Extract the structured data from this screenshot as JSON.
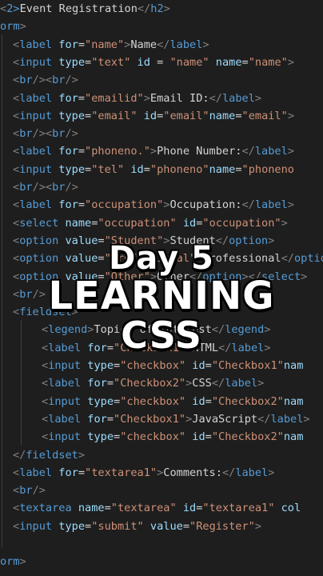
{
  "editor": {
    "lines": [
      [
        [
          "b",
          "<"
        ],
        [
          "n",
          "2>"
        ],
        [
          "x",
          "Event Registration"
        ],
        [
          "b",
          "</"
        ],
        [
          "t",
          "h2"
        ],
        [
          "b",
          ">"
        ]
      ],
      [
        [
          "t",
          "orm"
        ],
        [
          "b",
          ">"
        ]
      ],
      [
        [
          "b",
          "<"
        ],
        [
          "t",
          "label"
        ],
        [
          "x",
          " "
        ],
        [
          "a",
          "for"
        ],
        [
          "p",
          "="
        ],
        [
          "s",
          "\"name\""
        ],
        [
          "b",
          ">"
        ],
        [
          "x",
          "Name"
        ],
        [
          "b",
          "</"
        ],
        [
          "t",
          "label"
        ],
        [
          "b",
          ">"
        ]
      ],
      [
        [
          "b",
          "<"
        ],
        [
          "t",
          "input"
        ],
        [
          "x",
          " "
        ],
        [
          "a",
          "type"
        ],
        [
          "p",
          "="
        ],
        [
          "s",
          "\"text\""
        ],
        [
          "x",
          " "
        ],
        [
          "a",
          "id"
        ],
        [
          "p",
          " = "
        ],
        [
          "s",
          "\"name\""
        ],
        [
          "x",
          " "
        ],
        [
          "a",
          "name"
        ],
        [
          "p",
          "="
        ],
        [
          "s",
          "\"name\""
        ],
        [
          "b",
          ">"
        ]
      ],
      [
        [
          "b",
          "<"
        ],
        [
          "t",
          "br"
        ],
        [
          "b",
          "/><"
        ],
        [
          "t",
          "br"
        ],
        [
          "b",
          "/>"
        ]
      ],
      [
        [
          "b",
          "<"
        ],
        [
          "t",
          "label"
        ],
        [
          "x",
          " "
        ],
        [
          "a",
          "for"
        ],
        [
          "p",
          "="
        ],
        [
          "s",
          "\"emailid\""
        ],
        [
          "b",
          ">"
        ],
        [
          "x",
          "Email ID:"
        ],
        [
          "b",
          "</"
        ],
        [
          "t",
          "label"
        ],
        [
          "b",
          ">"
        ]
      ],
      [
        [
          "b",
          "<"
        ],
        [
          "t",
          "input"
        ],
        [
          "x",
          " "
        ],
        [
          "a",
          "type"
        ],
        [
          "p",
          "="
        ],
        [
          "s",
          "\"email\""
        ],
        [
          "x",
          " "
        ],
        [
          "a",
          "id"
        ],
        [
          "p",
          "="
        ],
        [
          "s",
          "\"email\""
        ],
        [
          "a",
          "name"
        ],
        [
          "p",
          "="
        ],
        [
          "s",
          "\"email\""
        ],
        [
          "b",
          ">"
        ]
      ],
      [
        [
          "b",
          "<"
        ],
        [
          "t",
          "br"
        ],
        [
          "b",
          "/><"
        ],
        [
          "t",
          "br"
        ],
        [
          "b",
          "/>"
        ]
      ],
      [
        [
          "b",
          "<"
        ],
        [
          "t",
          "label"
        ],
        [
          "x",
          " "
        ],
        [
          "a",
          "for"
        ],
        [
          "p",
          "="
        ],
        [
          "s",
          "\"phoneno.\""
        ],
        [
          "b",
          ">"
        ],
        [
          "x",
          "Phone Number:"
        ],
        [
          "b",
          "</"
        ],
        [
          "t",
          "label"
        ],
        [
          "b",
          ">"
        ]
      ],
      [
        [
          "b",
          "<"
        ],
        [
          "t",
          "input"
        ],
        [
          "x",
          " "
        ],
        [
          "a",
          "type"
        ],
        [
          "p",
          "="
        ],
        [
          "s",
          "\"tel\""
        ],
        [
          "x",
          " "
        ],
        [
          "a",
          "id"
        ],
        [
          "p",
          "="
        ],
        [
          "s",
          "\"phoneno\""
        ],
        [
          "a",
          "name"
        ],
        [
          "p",
          "="
        ],
        [
          "s",
          "\"phoneno"
        ]
      ],
      [
        [
          "b",
          "<"
        ],
        [
          "t",
          "br"
        ],
        [
          "b",
          "/><"
        ],
        [
          "t",
          "br"
        ],
        [
          "b",
          "/>"
        ]
      ],
      [
        [
          "b",
          "<"
        ],
        [
          "t",
          "label"
        ],
        [
          "x",
          " "
        ],
        [
          "a",
          "for"
        ],
        [
          "p",
          "="
        ],
        [
          "s",
          "\"occupation\""
        ],
        [
          "b",
          ">"
        ],
        [
          "x",
          "Occupation:"
        ],
        [
          "b",
          "</"
        ],
        [
          "t",
          "label"
        ],
        [
          "b",
          ">"
        ]
      ],
      [
        [
          "b",
          "<"
        ],
        [
          "t",
          "select"
        ],
        [
          "x",
          " "
        ],
        [
          "a",
          "name"
        ],
        [
          "p",
          "="
        ],
        [
          "s",
          "\"occupation\""
        ],
        [
          "x",
          " "
        ],
        [
          "a",
          "id"
        ],
        [
          "p",
          "="
        ],
        [
          "s",
          "\"occupation\""
        ],
        [
          "b",
          ">"
        ]
      ],
      [
        [
          "b",
          "<"
        ],
        [
          "t",
          "option"
        ],
        [
          "x",
          " "
        ],
        [
          "a",
          "value"
        ],
        [
          "p",
          "="
        ],
        [
          "s",
          "\"Student\""
        ],
        [
          "b",
          ">"
        ],
        [
          "x",
          "Student"
        ],
        [
          "b",
          "</"
        ],
        [
          "t",
          "option"
        ],
        [
          "b",
          ">"
        ]
      ],
      [
        [
          "b",
          "<"
        ],
        [
          "t",
          "option"
        ],
        [
          "x",
          " "
        ],
        [
          "a",
          "value"
        ],
        [
          "p",
          "="
        ],
        [
          "s",
          "\"Professional\""
        ],
        [
          "b",
          ">"
        ],
        [
          "x",
          "Professional"
        ],
        [
          "b",
          "</"
        ],
        [
          "t",
          "option"
        ],
        [
          "b",
          ">"
        ]
      ],
      [
        [
          "b",
          "<"
        ],
        [
          "t",
          "option"
        ],
        [
          "x",
          " "
        ],
        [
          "a",
          "value"
        ],
        [
          "p",
          "="
        ],
        [
          "s",
          "\"Other\""
        ],
        [
          "b",
          ">"
        ],
        [
          "x",
          "Other"
        ],
        [
          "b",
          "</"
        ],
        [
          "t",
          "option"
        ],
        [
          "b",
          "></"
        ],
        [
          "t",
          "select"
        ],
        [
          "b",
          ">"
        ]
      ],
      [
        [
          "b",
          "<"
        ],
        [
          "t",
          "br"
        ],
        [
          "b",
          "/>"
        ]
      ],
      [
        [
          "b",
          "<"
        ],
        [
          "t",
          "fieldset"
        ],
        [
          "b",
          ">"
        ]
      ],
      [
        [
          "b",
          "<"
        ],
        [
          "t",
          "legend"
        ],
        [
          "b",
          ">"
        ],
        [
          "x",
          "Topics of interest"
        ],
        [
          "b",
          "</"
        ],
        [
          "t",
          "legend"
        ],
        [
          "b",
          ">"
        ]
      ],
      [
        [
          "b",
          "<"
        ],
        [
          "t",
          "label"
        ],
        [
          "x",
          " "
        ],
        [
          "a",
          "for"
        ],
        [
          "p",
          "="
        ],
        [
          "s",
          "\"Checkbox1\""
        ],
        [
          "b",
          ">"
        ],
        [
          "x",
          "HTML"
        ],
        [
          "b",
          "</"
        ],
        [
          "t",
          "label"
        ],
        [
          "b",
          ">"
        ]
      ],
      [
        [
          "b",
          "<"
        ],
        [
          "t",
          "input"
        ],
        [
          "x",
          " "
        ],
        [
          "a",
          "type"
        ],
        [
          "p",
          "="
        ],
        [
          "s",
          "\"checkbox\""
        ],
        [
          "x",
          " "
        ],
        [
          "a",
          "id"
        ],
        [
          "p",
          "="
        ],
        [
          "s",
          "\"Checkbox1\""
        ],
        [
          "a",
          "nam"
        ]
      ],
      [
        [
          "b",
          "<"
        ],
        [
          "t",
          "label"
        ],
        [
          "x",
          " "
        ],
        [
          "a",
          "for"
        ],
        [
          "p",
          "="
        ],
        [
          "s",
          "\"Checkbox2\""
        ],
        [
          "b",
          ">"
        ],
        [
          "x",
          "CSS"
        ],
        [
          "b",
          "</"
        ],
        [
          "t",
          "label"
        ],
        [
          "b",
          ">"
        ]
      ],
      [
        [
          "b",
          "<"
        ],
        [
          "t",
          "input"
        ],
        [
          "x",
          " "
        ],
        [
          "a",
          "type"
        ],
        [
          "p",
          "="
        ],
        [
          "s",
          "\"checkbox\""
        ],
        [
          "x",
          " "
        ],
        [
          "a",
          "id"
        ],
        [
          "p",
          "="
        ],
        [
          "s",
          "\"Checkbox2\""
        ],
        [
          "a",
          "nam"
        ]
      ],
      [
        [
          "b",
          "<"
        ],
        [
          "t",
          "label"
        ],
        [
          "x",
          " "
        ],
        [
          "a",
          "for"
        ],
        [
          "p",
          "="
        ],
        [
          "s",
          "\"Checkbox1\""
        ],
        [
          "b",
          ">"
        ],
        [
          "x",
          "JavaScript"
        ],
        [
          "b",
          "</"
        ],
        [
          "t",
          "label"
        ],
        [
          "b",
          ">"
        ]
      ],
      [
        [
          "b",
          "<"
        ],
        [
          "t",
          "input"
        ],
        [
          "x",
          " "
        ],
        [
          "a",
          "type"
        ],
        [
          "p",
          "="
        ],
        [
          "s",
          "\"checkbox\""
        ],
        [
          "x",
          " "
        ],
        [
          "a",
          "id"
        ],
        [
          "p",
          "="
        ],
        [
          "s",
          "\"Checkbox2\""
        ],
        [
          "a",
          "nam"
        ]
      ],
      [
        [
          "b",
          "</"
        ],
        [
          "t",
          "fieldset"
        ],
        [
          "b",
          ">"
        ]
      ],
      [
        [
          "b",
          "<"
        ],
        [
          "t",
          "label"
        ],
        [
          "x",
          " "
        ],
        [
          "a",
          "for"
        ],
        [
          "p",
          "="
        ],
        [
          "s",
          "\"textarea1\""
        ],
        [
          "b",
          ">"
        ],
        [
          "x",
          "Comments:"
        ],
        [
          "b",
          "</"
        ],
        [
          "t",
          "label"
        ],
        [
          "b",
          ">"
        ]
      ],
      [
        [
          "b",
          "<"
        ],
        [
          "t",
          "br"
        ],
        [
          "b",
          "/>"
        ]
      ],
      [
        [
          "b",
          "<"
        ],
        [
          "t",
          "textarea"
        ],
        [
          "x",
          " "
        ],
        [
          "a",
          "name"
        ],
        [
          "p",
          "="
        ],
        [
          "s",
          "\"textarea\""
        ],
        [
          "x",
          " "
        ],
        [
          "a",
          "id"
        ],
        [
          "p",
          "="
        ],
        [
          "s",
          "\"textarea1\""
        ],
        [
          "x",
          " "
        ],
        [
          "a",
          "col"
        ]
      ],
      [
        [
          "b",
          "<"
        ],
        [
          "t",
          "input"
        ],
        [
          "x",
          " "
        ],
        [
          "a",
          "type"
        ],
        [
          "p",
          "="
        ],
        [
          "s",
          "\"submit\""
        ],
        [
          "x",
          " "
        ],
        [
          "a",
          "value"
        ],
        [
          "p",
          "="
        ],
        [
          "s",
          "\"Register\""
        ],
        [
          "b",
          ">"
        ]
      ],
      [],
      [
        [
          "t",
          "orm"
        ],
        [
          "b",
          ">"
        ]
      ]
    ],
    "indents": [
      0,
      0,
      1,
      1,
      1,
      1,
      1,
      1,
      1,
      1,
      1,
      1,
      1,
      1,
      1,
      1,
      1,
      1,
      2,
      2,
      2,
      2,
      2,
      2,
      2,
      1,
      1,
      1,
      1,
      1,
      0,
      0
    ]
  },
  "overlay": {
    "line1": "Day 5",
    "line2": "LEARNING",
    "line3": "CSS"
  }
}
